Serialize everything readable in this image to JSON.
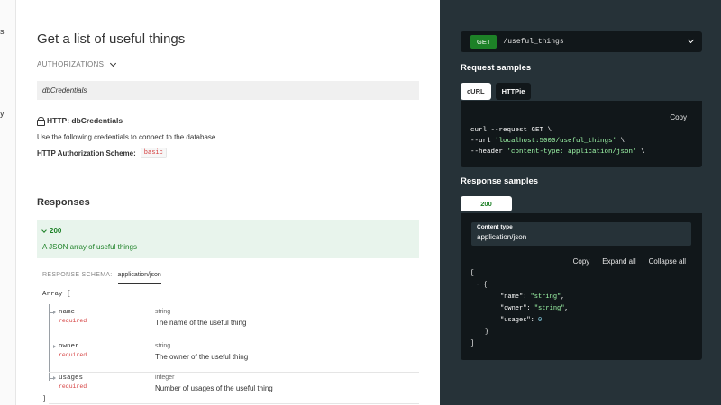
{
  "sidebar": {
    "frag1": "s",
    "frag2": "y"
  },
  "operation": {
    "title": "Get a list of useful things",
    "authorizations_label": "AUTHORIZATIONS:",
    "credential_name": "dbCredentials",
    "http_label": "HTTP: dbCredentials",
    "http_description": "Use the following credentials to connect to the database.",
    "scheme_label": "HTTP Authorization Scheme:",
    "scheme_value": "basic"
  },
  "responses": {
    "title": "Responses",
    "code": "200",
    "description": "A JSON array of useful things",
    "schema_label": "RESPONSE SCHEMA:",
    "schema_type": "application/json",
    "array_open": "Array [",
    "array_close": "]",
    "fields": [
      {
        "name": "name",
        "required": "required",
        "type": "string",
        "description": "The name of the useful thing"
      },
      {
        "name": "owner",
        "required": "required",
        "type": "string",
        "description": "The owner of the useful thing"
      },
      {
        "name": "usages",
        "required": "required",
        "type": "integer",
        "description": "Number of usages of the useful thing"
      }
    ]
  },
  "right": {
    "method": "GET",
    "path": "/useful_things",
    "request_samples_title": "Request samples",
    "tabs": [
      "cURL",
      "HTTPie"
    ],
    "copy_label": "Copy",
    "curl": {
      "l1": "curl --request GET \\",
      "l2a": "--url ",
      "l2b": "'localhost:5000/useful_things'",
      "l2c": " \\",
      "l3a": "--header ",
      "l3b": "'content-type: application/json'",
      "l3c": " \\"
    },
    "response_samples_title": "Response samples",
    "response_tab": "200",
    "content_type_label": "Content type",
    "content_type_value": "application/json",
    "actions": {
      "copy": "Copy",
      "expand": "Expand all",
      "collapse": "Collapse all"
    },
    "json": {
      "open": "[",
      "obj_open": "{",
      "k_name": "\"name\": ",
      "v_name": "\"string\"",
      "k_owner": "\"owner\": ",
      "v_owner": "\"string\"",
      "k_usages": "\"usages\": ",
      "v_usages": "0",
      "obj_close": "}",
      "close": "]",
      "collapser": "-"
    }
  },
  "colors": {
    "dark_panel": "#263238",
    "code_bg": "#11171a",
    "green": "#1d8127",
    "red": "#d43d3d"
  }
}
